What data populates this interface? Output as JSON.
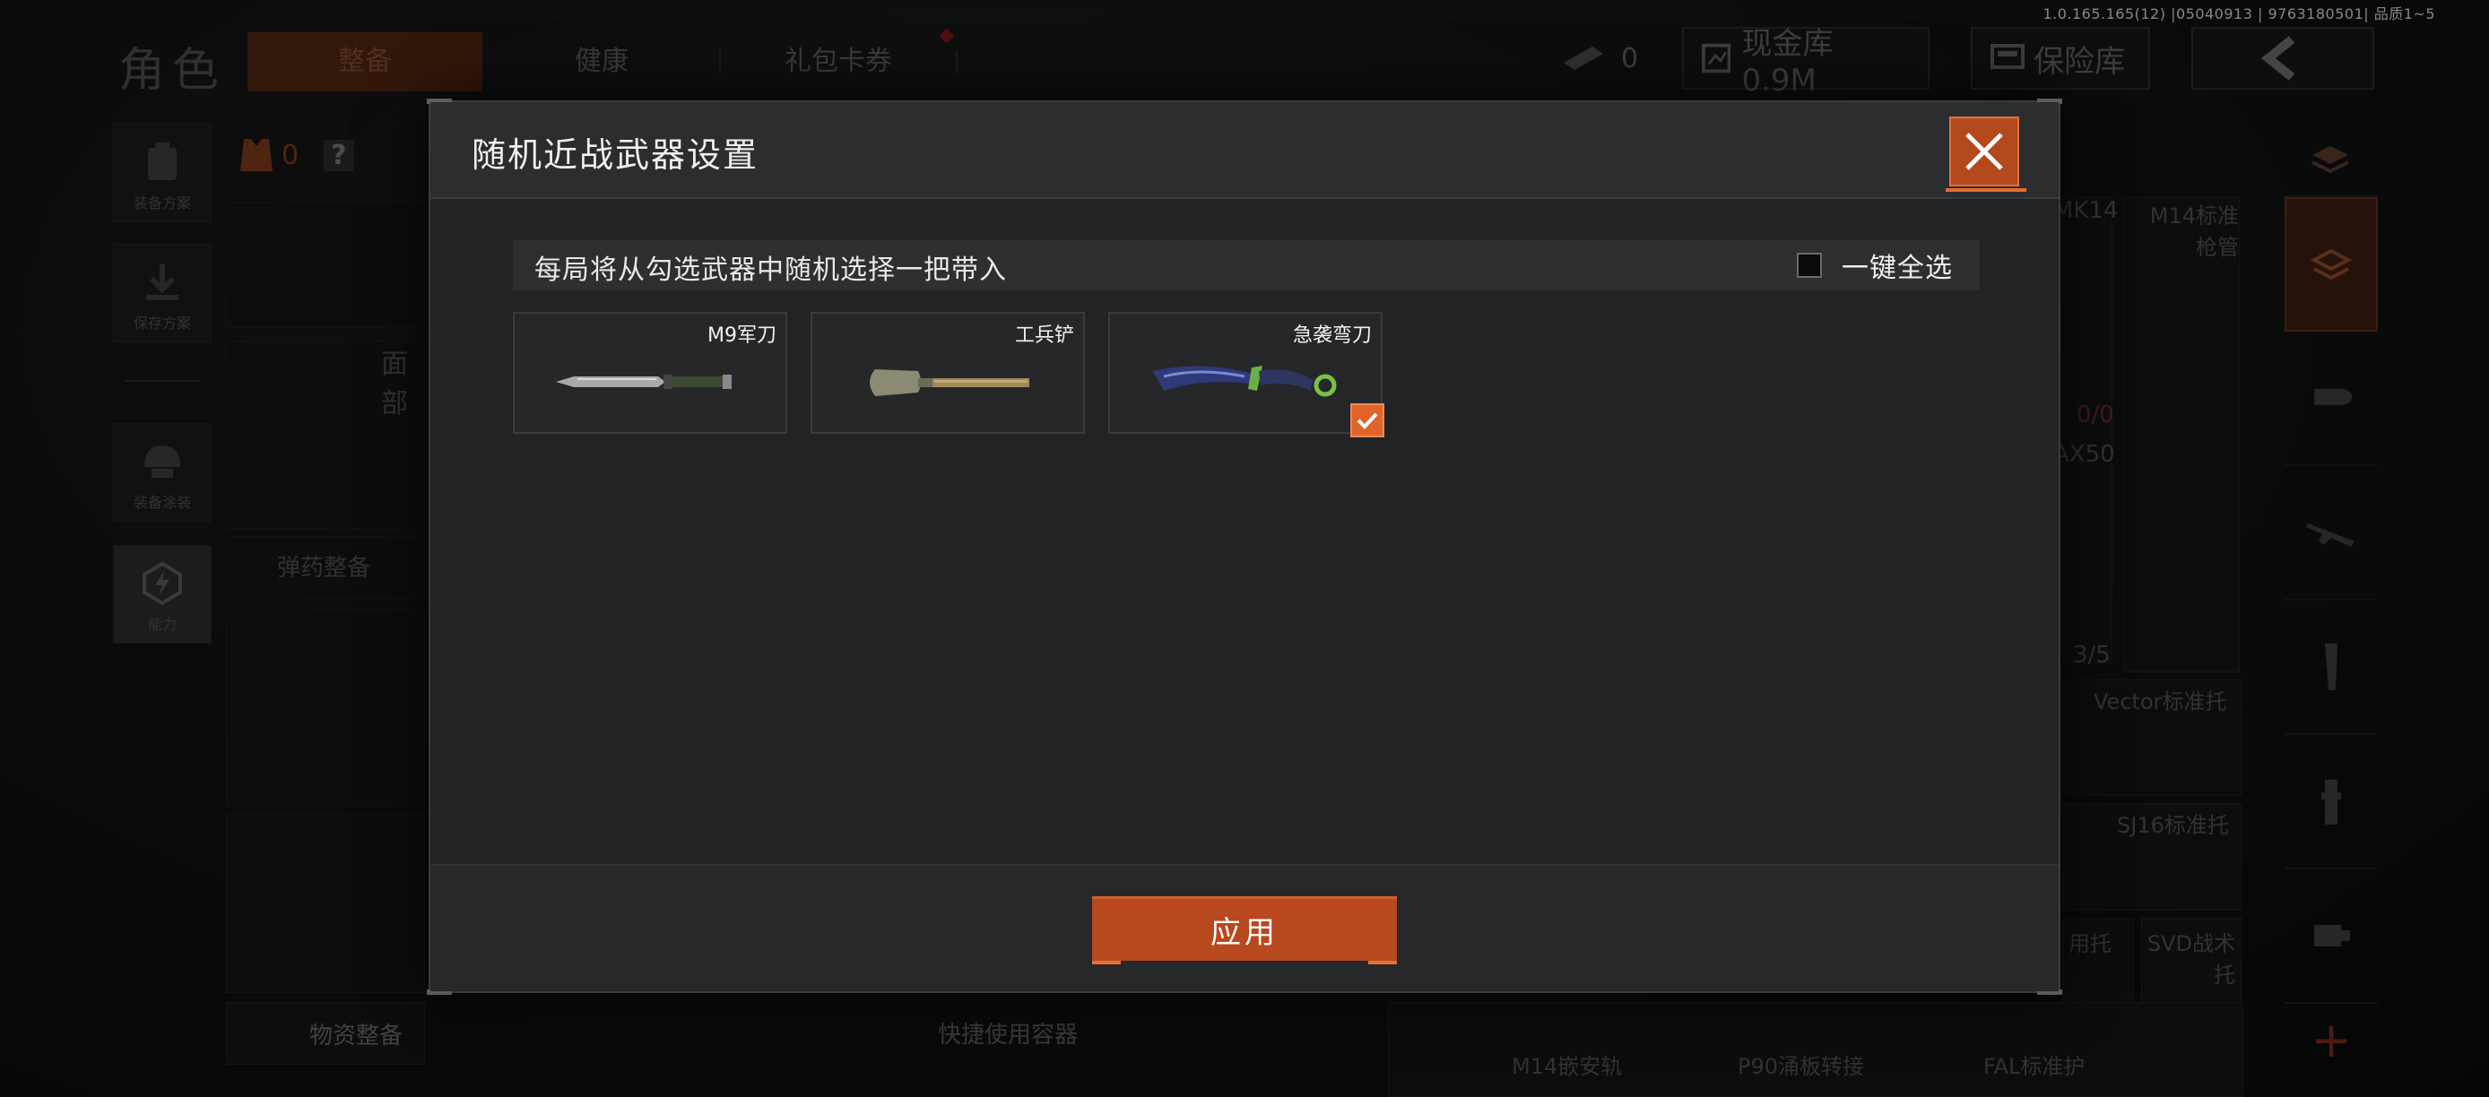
{
  "version": "1.0.165.165(12) |05040913 | 9763180501| 品质1~5",
  "background": {
    "page_title": "角色",
    "tabs": [
      {
        "label": "整备",
        "active": true
      },
      {
        "label": "健康",
        "active": false
      },
      {
        "label": "礼包卡券",
        "active": false
      }
    ],
    "currency": {
      "count": "0",
      "cash_label": "现金库 0.9M",
      "vault_label": "保险库"
    },
    "left_menu": [
      {
        "label": "装备方案"
      },
      {
        "label": "保存方案"
      },
      {
        "label": "装备涂装"
      },
      {
        "label": "能力"
      }
    ],
    "armor_count": "0",
    "help": "?",
    "face_label": "面部",
    "ammo_label": "弹药整备",
    "supply_label": "物资整备",
    "quick_container_label": "快捷使用容器",
    "right_items": [
      "MK14",
      "M14标准\n枪管",
      "0/0",
      "AX50",
      "3/5",
      "Vector标准托",
      "SJ16标准托",
      "用托",
      "SVD战术\n托",
      "M14嵌安轨",
      "P90涌板转接",
      "FAL标准护"
    ],
    "add_icon": "+"
  },
  "modal": {
    "title": "随机近战武器设置",
    "info": "每局将从勾选武器中随机选择一把带入",
    "select_all_label": "一键全选",
    "select_all_checked": false,
    "weapons": [
      {
        "name": "M9军刀",
        "icon": "bayonet-knife",
        "checked": false
      },
      {
        "name": "工兵铲",
        "icon": "entrenching-shovel",
        "checked": false
      },
      {
        "name": "急袭弯刀",
        "icon": "karambit-knife",
        "checked": true
      }
    ],
    "apply_label": "应用"
  },
  "colors": {
    "accent": "#b8481d",
    "check": "#e0642a",
    "modal_bg": "#222325"
  }
}
